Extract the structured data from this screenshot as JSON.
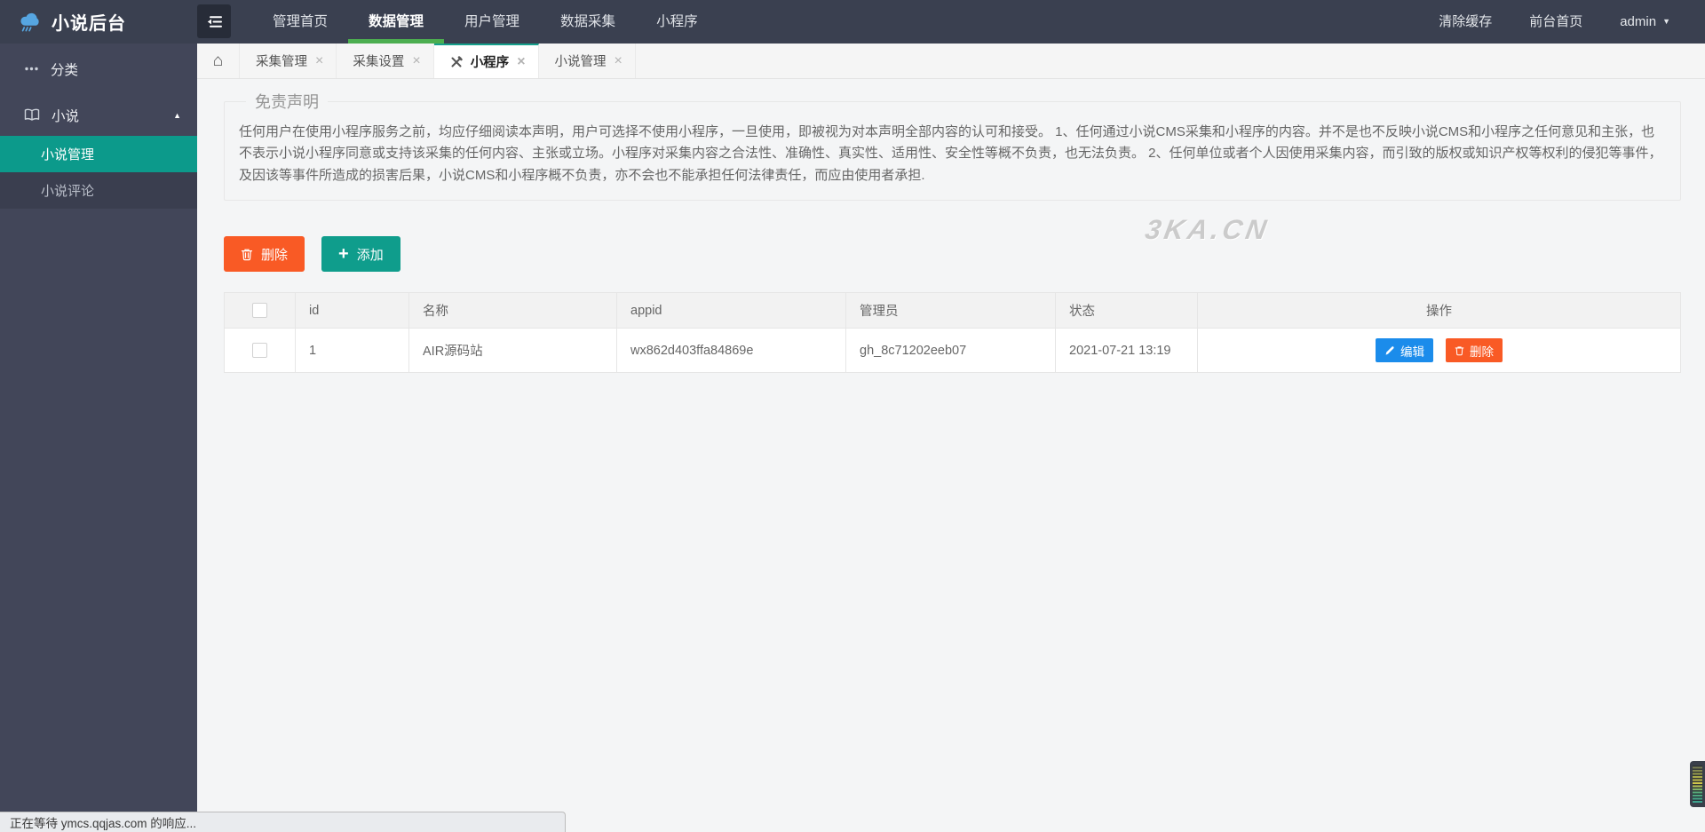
{
  "header": {
    "logo_text": "小说后台",
    "nav_items": [
      {
        "label": "管理首页"
      },
      {
        "label": "数据管理"
      },
      {
        "label": "用户管理"
      },
      {
        "label": "数据采集"
      },
      {
        "label": "小程序"
      }
    ],
    "actions": {
      "clear_cache": "清除缓存",
      "front_home": "前台首页",
      "username": "admin"
    }
  },
  "sidebar": {
    "category_label": "分类",
    "novel_label": "小说",
    "novel_children": [
      {
        "label": "小说管理"
      },
      {
        "label": "小说评论"
      }
    ]
  },
  "tabbar": {
    "tabs": [
      {
        "label": "采集管理"
      },
      {
        "label": "采集设置"
      },
      {
        "label": "小程序"
      },
      {
        "label": "小说管理"
      }
    ]
  },
  "content": {
    "disclaimer_title": "免责声明",
    "disclaimer_text": "任何用户在使用小程序服务之前，均应仔细阅读本声明，用户可选择不使用小程序，一旦使用，即被视为对本声明全部内容的认可和接受。 1、任何通过小说CMS采集和小程序的内容。并不是也不反映小说CMS和小程序之任何意见和主张，也不表示小说小程序同意或支持该采集的任何内容、主张或立场。小程序对采集内容之合法性、准确性、真实性、适用性、安全性等概不负责，也无法负责。 2、任何单位或者个人因使用采集内容，而引致的版权或知识产权等权利的侵犯等事件，及因该等事件所造成的损害后果，小说CMS和小程序概不负责，亦不会也不能承担任何法律责任，而应由使用者承担.",
    "toolbar": {
      "delete_label": "删除",
      "add_label": "添加"
    },
    "watermark": "3KA.CN",
    "table": {
      "columns": [
        "id",
        "名称",
        "appid",
        "管理员",
        "状态",
        "操作"
      ],
      "rows": [
        {
          "id": "1",
          "name": "AIR源码站",
          "appid": "wx862d403ffa84869e",
          "admin": "gh_8c71202eeb07",
          "status": "2021-07-21 13:19"
        }
      ],
      "actions": {
        "edit": "编辑",
        "delete": "删除"
      }
    }
  },
  "statusbar": {
    "text": "正在等待 ymcs.qqjas.com 的响应..."
  },
  "colors": {
    "header_bg": "#3a4050",
    "sidebar_bg": "#424659",
    "submenu_bg": "#3a3e4f",
    "active_teal": "#0c9a8b",
    "nav_active_green": "#4cae50",
    "tab_active_border": "#16a08c",
    "danger_orange": "#f95a25",
    "add_teal": "#0f9d8c",
    "edit_blue": "#1b8ceb"
  }
}
